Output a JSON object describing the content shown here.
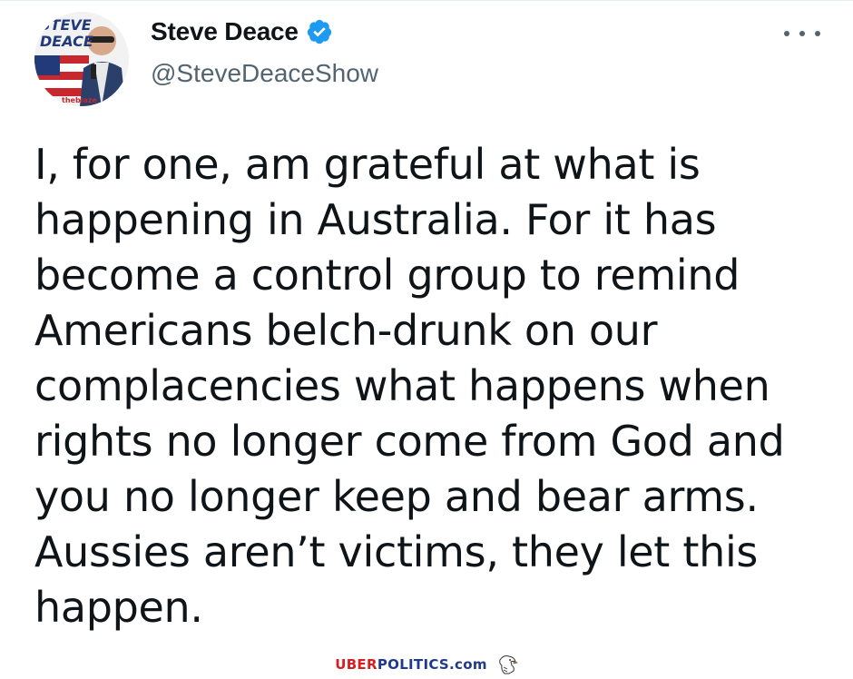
{
  "tweet": {
    "display_name": "Steve Deace",
    "handle": "@SteveDeaceShow",
    "verified": true,
    "avatar_text": "STEVE DEACE",
    "avatar_badge": "theblaze",
    "text": "I, for one, am grateful at what is\nhappening in Australia. For it has\nbecome a control group to remind\nAmericans belch-drunk on our\ncomplacencies what happens when\nrights no longer come from God and\nyou no longer keep and bear arms.\nAussies aren’t victims, they let this\nhappen.",
    "more_icon": "more-options-icon"
  },
  "watermark": {
    "part1": "UBER",
    "part2": "POLITICS.com",
    "icon": "eagle-icon"
  },
  "colors": {
    "verified_blue": "#1d9bf0",
    "text": "#0f1419",
    "handle_gray": "#536471",
    "watermark_red": "#d42020",
    "watermark_blue": "#1f3a8a"
  }
}
